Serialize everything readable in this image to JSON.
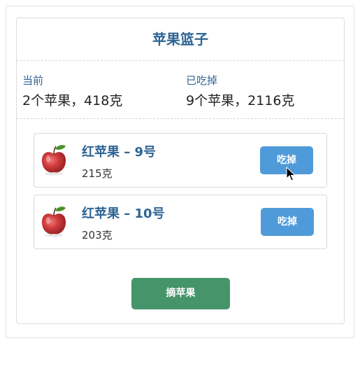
{
  "basket": {
    "title": "苹果篮子"
  },
  "stats": {
    "current_label": "当前",
    "current_value": "2个苹果，418克",
    "eaten_label": "已吃掉",
    "eaten_value": "9个苹果，2116克"
  },
  "apples": [
    {
      "name": "红苹果 – 9号",
      "weight": "215克",
      "eat_label": "吃掉",
      "icon": "apple-icon"
    },
    {
      "name": "红苹果 – 10号",
      "weight": "203克",
      "eat_label": "吃掉",
      "icon": "apple-icon"
    }
  ],
  "actions": {
    "pick_label": "摘苹果"
  },
  "colors": {
    "heading": "#2e6494",
    "eat_button": "#4f9bd9",
    "pick_button": "#46956a"
  }
}
